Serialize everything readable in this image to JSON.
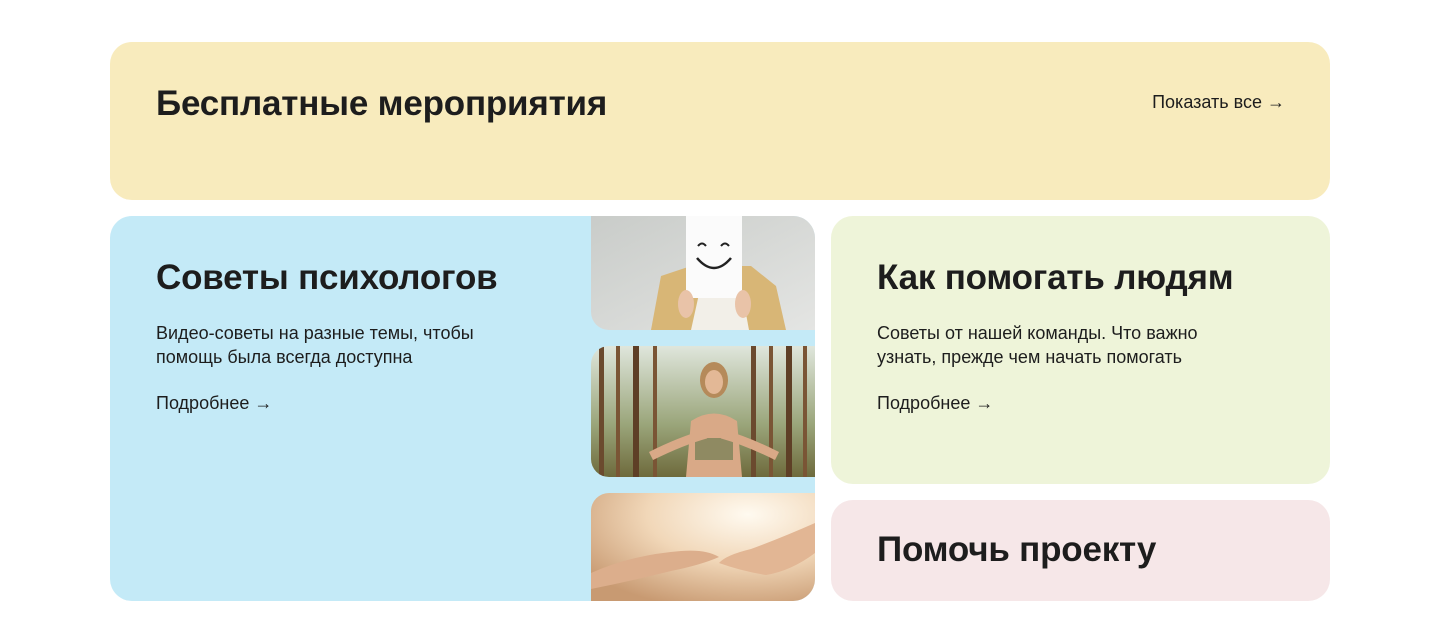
{
  "colors": {
    "events_bg": "#f8ebbd",
    "psy_bg": "#c4eaf7",
    "help_bg": "#eef4d9",
    "donate_bg": "#f6e7e8",
    "text": "#1d1d1d"
  },
  "events": {
    "title": "Бесплатные мероприятия",
    "show_all": "Показать все →"
  },
  "psychologists": {
    "title": "Советы психологов",
    "description_line1": "Видео-советы на разные темы, чтобы",
    "description_line2": "помощь была всегда доступна",
    "more": "Подробнее →",
    "images": [
      "smiley-face-paper-photo",
      "woman-in-forest-photo",
      "reaching-hands-photo"
    ]
  },
  "help_people": {
    "title": "Как помогать людям",
    "description_line1": "Советы от нашей команды. Что важно",
    "description_line2": "узнать, прежде чем начать помогать",
    "more": "Подробнее →"
  },
  "donate": {
    "title": "Помочь проекту"
  }
}
